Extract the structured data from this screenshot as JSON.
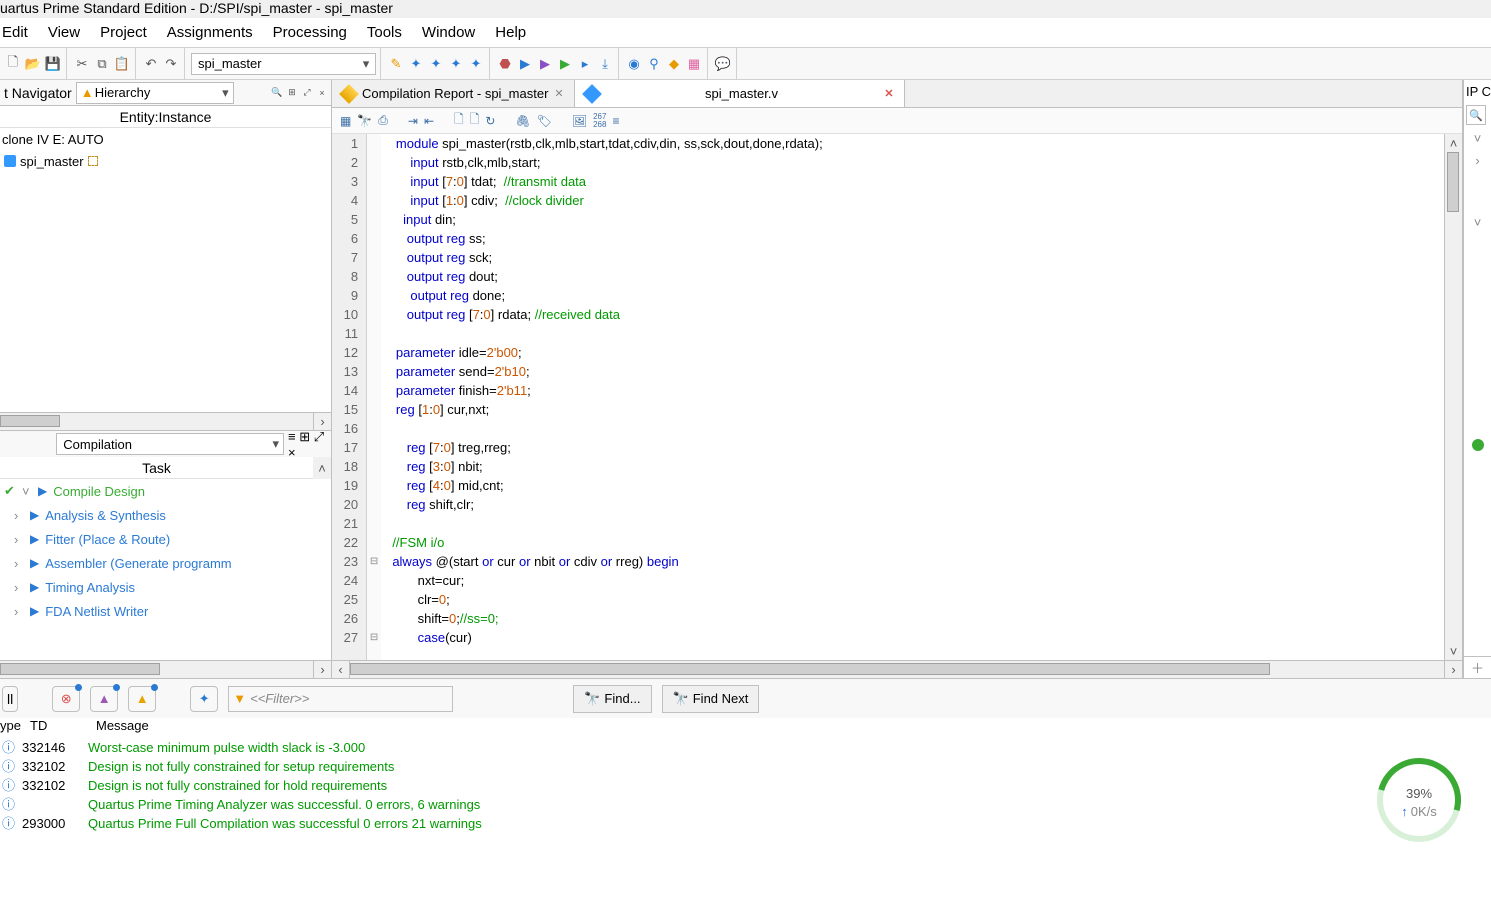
{
  "title": "uartus Prime Standard Edition - D:/SPI/spi_master - spi_master",
  "menu": [
    "Edit",
    "View",
    "Project",
    "Assignments",
    "Processing",
    "Tools",
    "Window",
    "Help"
  ],
  "project_selector": "spi_master",
  "nav": {
    "panel_label": "t Navigator",
    "dropdown": "Hierarchy",
    "entity_header": "Entity:Instance",
    "rows": [
      {
        "label": "clone IV E: AUTO",
        "type": "device"
      },
      {
        "label": "spi_master",
        "type": "instance"
      }
    ]
  },
  "tasks": {
    "dropdown": "Compilation",
    "col": "Task",
    "items": [
      {
        "label": "Compile Design",
        "expanded": true,
        "status": "running",
        "color": "green"
      },
      {
        "label": "Analysis & Synthesis",
        "color": "blue"
      },
      {
        "label": "Fitter (Place & Route)",
        "color": "blue"
      },
      {
        "label": "Assembler (Generate programm",
        "color": "blue"
      },
      {
        "label": "Timing Analysis",
        "color": "blue"
      },
      {
        "label": "FDA Netlist Writer",
        "color": "blue"
      }
    ]
  },
  "tabs": [
    {
      "label": "Compilation Report - spi_master",
      "icon": "gold",
      "close": "x"
    },
    {
      "label": "spi_master.v",
      "icon": "blue",
      "close": "red"
    }
  ],
  "right_label": "IP C",
  "code_lines": [
    {
      "n": 1,
      "segs": [
        [
          "   ",
          ""
        ],
        [
          "module",
          "kw"
        ],
        [
          " spi_master(rstb,clk,mlb,start,tdat,cdiv,din, ss,sck,dout,done,rdata);",
          ""
        ]
      ]
    },
    {
      "n": 2,
      "segs": [
        [
          "       ",
          ""
        ],
        [
          "input",
          "kw"
        ],
        [
          " rstb,clk,mlb,start;",
          ""
        ]
      ]
    },
    {
      "n": 3,
      "segs": [
        [
          "       ",
          ""
        ],
        [
          "input",
          "kw"
        ],
        [
          " [",
          ""
        ],
        [
          "7",
          "num"
        ],
        [
          ":",
          ""
        ],
        [
          "0",
          "num"
        ],
        [
          "] tdat;  ",
          ""
        ],
        [
          "//transmit data",
          "cmt"
        ]
      ]
    },
    {
      "n": 4,
      "segs": [
        [
          "       ",
          ""
        ],
        [
          "input",
          "kw"
        ],
        [
          " [",
          ""
        ],
        [
          "1",
          "num"
        ],
        [
          ":",
          ""
        ],
        [
          "0",
          "num"
        ],
        [
          "] cdiv;  ",
          ""
        ],
        [
          "//clock divider",
          "cmt"
        ]
      ]
    },
    {
      "n": 5,
      "segs": [
        [
          "     ",
          ""
        ],
        [
          "input",
          "kw"
        ],
        [
          " din;",
          ""
        ]
      ]
    },
    {
      "n": 6,
      "segs": [
        [
          "      ",
          ""
        ],
        [
          "output",
          "kw"
        ],
        [
          " ",
          ""
        ],
        [
          "reg",
          "kw"
        ],
        [
          " ss;",
          ""
        ]
      ]
    },
    {
      "n": 7,
      "segs": [
        [
          "      ",
          ""
        ],
        [
          "output",
          "kw"
        ],
        [
          " ",
          ""
        ],
        [
          "reg",
          "kw"
        ],
        [
          " sck;",
          ""
        ]
      ]
    },
    {
      "n": 8,
      "segs": [
        [
          "      ",
          ""
        ],
        [
          "output",
          "kw"
        ],
        [
          " ",
          ""
        ],
        [
          "reg",
          "kw"
        ],
        [
          " dout;",
          ""
        ]
      ]
    },
    {
      "n": 9,
      "segs": [
        [
          "       ",
          ""
        ],
        [
          "output",
          "kw"
        ],
        [
          " ",
          ""
        ],
        [
          "reg",
          "kw"
        ],
        [
          " done;",
          ""
        ]
      ]
    },
    {
      "n": 10,
      "segs": [
        [
          "      ",
          ""
        ],
        [
          "output",
          "kw"
        ],
        [
          " ",
          ""
        ],
        [
          "reg",
          "kw"
        ],
        [
          " [",
          ""
        ],
        [
          "7",
          "num"
        ],
        [
          ":",
          ""
        ],
        [
          "0",
          "num"
        ],
        [
          "] rdata; ",
          ""
        ],
        [
          "//received data",
          "cmt"
        ]
      ]
    },
    {
      "n": 11,
      "segs": [
        [
          "",
          ""
        ]
      ]
    },
    {
      "n": 12,
      "segs": [
        [
          "   ",
          ""
        ],
        [
          "parameter",
          "kw"
        ],
        [
          " idle=",
          ""
        ],
        [
          "2'b00",
          "num"
        ],
        [
          ";",
          ""
        ]
      ]
    },
    {
      "n": 13,
      "segs": [
        [
          "   ",
          ""
        ],
        [
          "parameter",
          "kw"
        ],
        [
          " send=",
          ""
        ],
        [
          "2'b10",
          "num"
        ],
        [
          ";",
          ""
        ]
      ]
    },
    {
      "n": 14,
      "segs": [
        [
          "   ",
          ""
        ],
        [
          "parameter",
          "kw"
        ],
        [
          " finish=",
          ""
        ],
        [
          "2'b11",
          "num"
        ],
        [
          ";",
          ""
        ]
      ]
    },
    {
      "n": 15,
      "segs": [
        [
          "   ",
          ""
        ],
        [
          "reg",
          "kw"
        ],
        [
          " [",
          ""
        ],
        [
          "1",
          "num"
        ],
        [
          ":",
          ""
        ],
        [
          "0",
          "num"
        ],
        [
          "] cur,nxt;",
          ""
        ]
      ]
    },
    {
      "n": 16,
      "segs": [
        [
          "",
          ""
        ]
      ]
    },
    {
      "n": 17,
      "segs": [
        [
          "      ",
          ""
        ],
        [
          "reg",
          "kw"
        ],
        [
          " [",
          ""
        ],
        [
          "7",
          "num"
        ],
        [
          ":",
          ""
        ],
        [
          "0",
          "num"
        ],
        [
          "] treg,rreg;",
          ""
        ]
      ]
    },
    {
      "n": 18,
      "segs": [
        [
          "      ",
          ""
        ],
        [
          "reg",
          "kw"
        ],
        [
          " [",
          ""
        ],
        [
          "3",
          "num"
        ],
        [
          ":",
          ""
        ],
        [
          "0",
          "num"
        ],
        [
          "] nbit;",
          ""
        ]
      ]
    },
    {
      "n": 19,
      "segs": [
        [
          "      ",
          ""
        ],
        [
          "reg",
          "kw"
        ],
        [
          " [",
          ""
        ],
        [
          "4",
          "num"
        ],
        [
          ":",
          ""
        ],
        [
          "0",
          "num"
        ],
        [
          "] mid,cnt;",
          ""
        ]
      ]
    },
    {
      "n": 20,
      "segs": [
        [
          "      ",
          ""
        ],
        [
          "reg",
          "kw"
        ],
        [
          " shift,clr;",
          ""
        ]
      ]
    },
    {
      "n": 21,
      "segs": [
        [
          "",
          ""
        ]
      ]
    },
    {
      "n": 22,
      "segs": [
        [
          "  ",
          ""
        ],
        [
          "//FSM i/o",
          "cmt"
        ]
      ]
    },
    {
      "n": 23,
      "fold": "⊟",
      "segs": [
        [
          "  ",
          ""
        ],
        [
          "always",
          "kw"
        ],
        [
          " @(start ",
          ""
        ],
        [
          "or",
          "kw"
        ],
        [
          " cur ",
          ""
        ],
        [
          "or",
          "kw"
        ],
        [
          " nbit ",
          ""
        ],
        [
          "or",
          "kw"
        ],
        [
          " cdiv ",
          ""
        ],
        [
          "or",
          "kw"
        ],
        [
          " rreg) ",
          ""
        ],
        [
          "begin",
          "kw"
        ]
      ]
    },
    {
      "n": 24,
      "segs": [
        [
          "         nxt=cur;",
          ""
        ]
      ]
    },
    {
      "n": 25,
      "segs": [
        [
          "         clr=",
          ""
        ],
        [
          "0",
          "num"
        ],
        [
          ";",
          ""
        ]
      ]
    },
    {
      "n": 26,
      "segs": [
        [
          "         shift=",
          ""
        ],
        [
          "0",
          "num"
        ],
        [
          ";",
          ""
        ],
        [
          "//ss=0;",
          "cmt"
        ]
      ]
    },
    {
      "n": 27,
      "fold": "⊟",
      "segs": [
        [
          "         ",
          ""
        ],
        [
          "case",
          "kw"
        ],
        [
          "(cur)",
          ""
        ]
      ]
    }
  ],
  "msg_filter_placeholder": "<<Filter>>",
  "find_label": "Find...",
  "find_next_label": "Find Next",
  "msg_hdr": {
    "type": "ype",
    "id": "TD",
    "msg": "Message"
  },
  "messages": [
    {
      "id": "332146",
      "txt": "Worst-case minimum pulse width slack is -3.000"
    },
    {
      "id": "332102",
      "txt": "Design is not fully constrained for setup requirements"
    },
    {
      "id": "332102",
      "txt": "Design is not fully constrained for hold requirements"
    },
    {
      "id": "",
      "txt": "Quartus Prime Timing Analyzer was successful. 0 errors, 6 warnings"
    },
    {
      "id": "293000",
      "txt": "Quartus Prime Full Compilation was successful  0 errors  21 warnings"
    }
  ],
  "msg_tab": "ll",
  "perf": {
    "pct": "39",
    "unit": "%",
    "rate": "0K/s"
  }
}
